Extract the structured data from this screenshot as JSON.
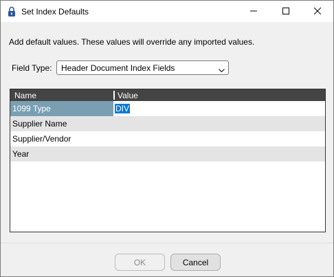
{
  "window": {
    "title": "Set Index Defaults",
    "icon": "lock-icon",
    "controls": {
      "minimize": "minimize-icon",
      "maximize": "maximize-icon",
      "close": "close-icon"
    }
  },
  "intro_text": "Add default values. These values will override any imported values.",
  "field_type": {
    "label": "Field Type:",
    "selected": "Header Document Index Fields"
  },
  "grid": {
    "columns": [
      "Name",
      "Value"
    ],
    "rows": [
      {
        "name": "1099 Type",
        "value": "DIV"
      },
      {
        "name": "Supplier Name",
        "value": ""
      },
      {
        "name": "Supplier/Vendor",
        "value": ""
      },
      {
        "name": "Year",
        "value": ""
      }
    ],
    "colors": {
      "header_bg": "#444444",
      "selected_name_bg": "#7a9fb3",
      "alt_row_bg": "#e4e4e4",
      "selection": "#0078d7"
    }
  },
  "buttons": {
    "ok": "OK",
    "cancel": "Cancel"
  }
}
